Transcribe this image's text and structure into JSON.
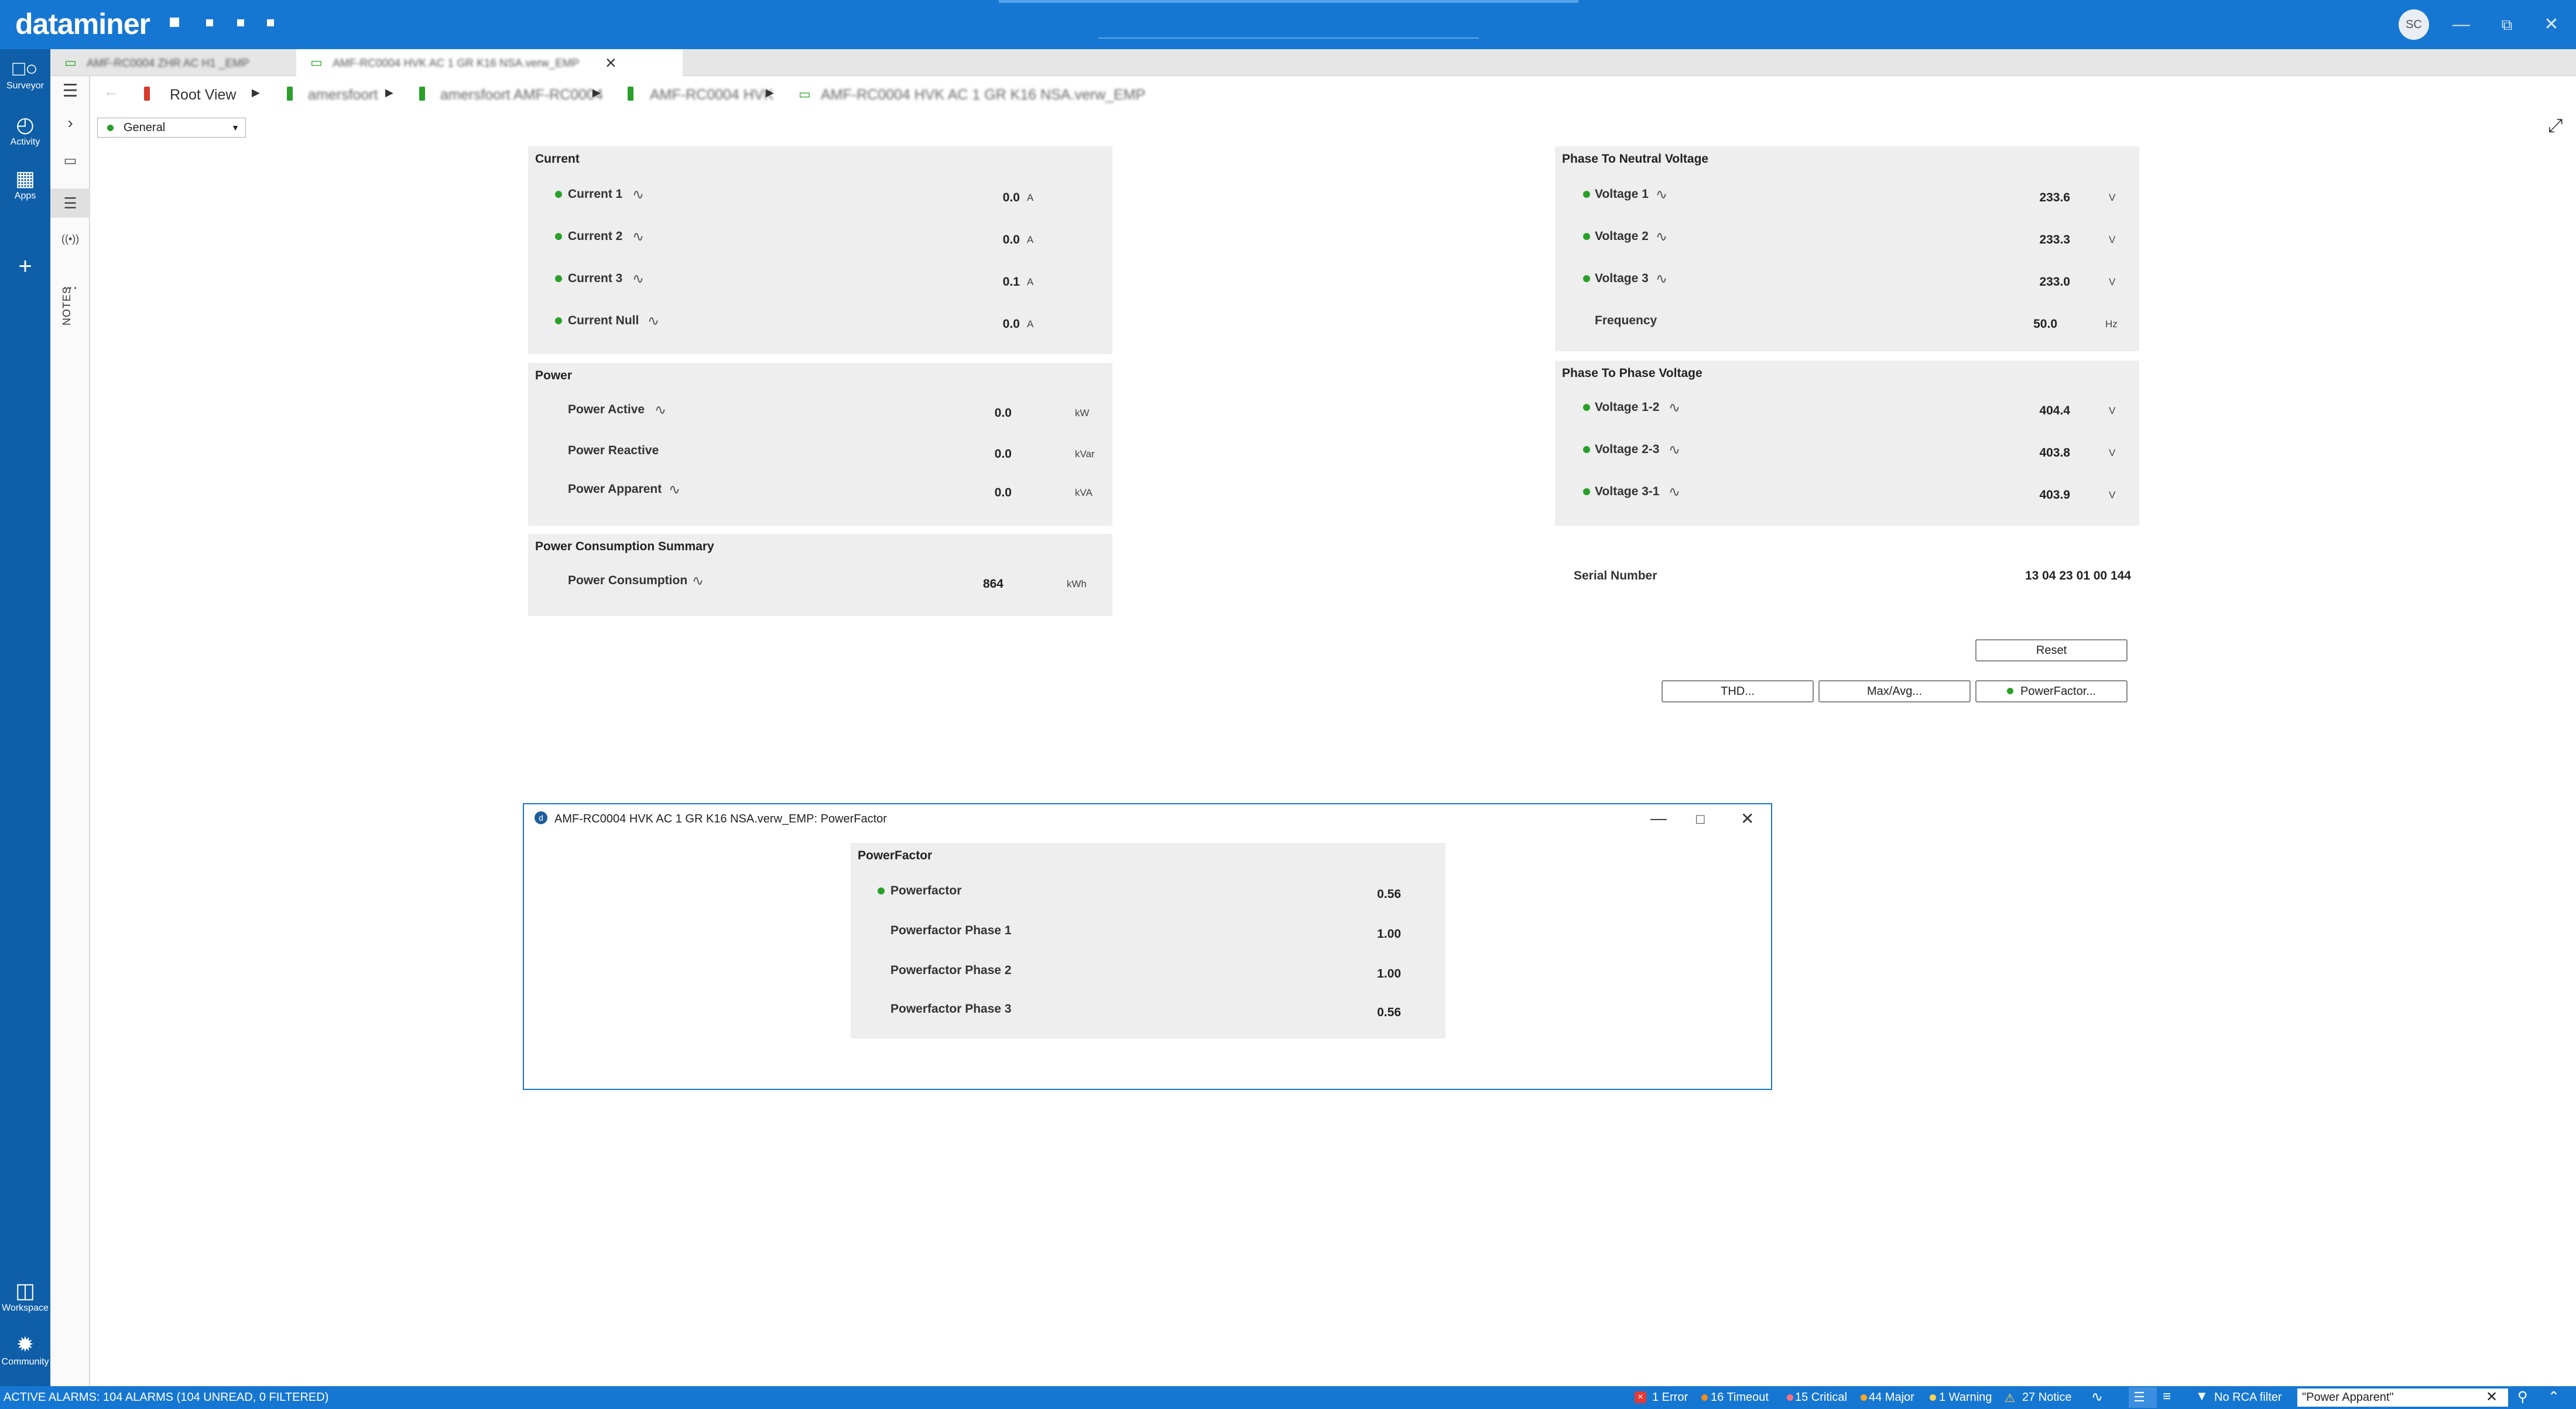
{
  "app": {
    "brand": "dataminer",
    "avatar_initials": "SC"
  },
  "leftrail": {
    "items": [
      {
        "label": "Surveyor",
        "icon": "surveyor-icon"
      },
      {
        "label": "Activity",
        "icon": "activity-icon"
      },
      {
        "label": "Apps",
        "icon": "apps-icon"
      },
      {
        "label": "Workspace",
        "icon": "workspace-icon"
      },
      {
        "label": "Community",
        "icon": "community-icon"
      }
    ]
  },
  "notes_label": "NOTES",
  "tabs": [
    {
      "label": "AMF-RC0004 ZHR AC H1 _EMP"
    },
    {
      "label": "AMF-RC0004 HVK AC 1 GR K16 NSA.verw_EMP"
    }
  ],
  "breadcrumb": {
    "root": "Root View",
    "items": [
      "amersfoort",
      "amersfoort AMF-RC0004",
      "AMF-RC0004 HVK",
      "AMF-RC0004 HVK AC 1 GR K16 NSA.verw_EMP"
    ]
  },
  "view_select": "General",
  "panels": {
    "current": {
      "title": "Current",
      "rows": [
        {
          "label": "Current 1",
          "value": "0.0",
          "unit": "A"
        },
        {
          "label": "Current 2",
          "value": "0.0",
          "unit": "A"
        },
        {
          "label": "Current 3",
          "value": "0.1",
          "unit": "A"
        },
        {
          "label": "Current Null",
          "value": "0.0",
          "unit": "A"
        }
      ]
    },
    "power": {
      "title": "Power",
      "rows": [
        {
          "label": "Power Active",
          "value": "0.0",
          "unit": "kW"
        },
        {
          "label": "Power Reactive",
          "value": "0.0",
          "unit": "kVar"
        },
        {
          "label": "Power Apparent",
          "value": "0.0",
          "unit": "kVA"
        }
      ]
    },
    "consumption": {
      "title": "Power Consumption Summary",
      "rows": [
        {
          "label": "Power Consumption",
          "value": "864",
          "unit": "kWh"
        }
      ]
    },
    "neutral": {
      "title": "Phase To Neutral Voltage",
      "rows": [
        {
          "label": "Voltage 1",
          "value": "233.6",
          "unit": "V"
        },
        {
          "label": "Voltage 2",
          "value": "233.3",
          "unit": "V"
        },
        {
          "label": "Voltage 3",
          "value": "233.0",
          "unit": "V"
        },
        {
          "label": "Frequency",
          "value": "50.0",
          "unit": "Hz"
        }
      ]
    },
    "phase": {
      "title": "Phase To Phase Voltage",
      "rows": [
        {
          "label": "Voltage 1-2",
          "value": "404.4",
          "unit": "V"
        },
        {
          "label": "Voltage 2-3",
          "value": "403.8",
          "unit": "V"
        },
        {
          "label": "Voltage 3-1",
          "value": "403.9",
          "unit": "V"
        }
      ]
    }
  },
  "serial": {
    "label": "Serial Number",
    "value": "13 04 23 01 00 144"
  },
  "buttons": {
    "reset": "Reset",
    "thd": "THD...",
    "maxavg": "Max/Avg...",
    "powerfactor": "PowerFactor..."
  },
  "popup": {
    "title": "AMF-RC0004 HVK AC 1 GR K16 NSA.verw_EMP: PowerFactor",
    "panel_title": "PowerFactor",
    "rows": [
      {
        "label": "Powerfactor",
        "value": "0.56"
      },
      {
        "label": "Powerfactor Phase 1",
        "value": "1.00"
      },
      {
        "label": "Powerfactor Phase 2",
        "value": "1.00"
      },
      {
        "label": "Powerfactor Phase 3",
        "value": "0.56"
      }
    ]
  },
  "statusbar": {
    "alarms": "ACTIVE ALARMS: 104 ALARMS (104 UNREAD, 0 FILTERED)",
    "error": "1 Error",
    "timeout": "16 Timeout",
    "critical": "15 Critical",
    "major": "44 Major",
    "warning": "1 Warning",
    "notice": "27 Notice",
    "rca": "No RCA filter",
    "search": "\"Power Apparent\""
  },
  "colors": {
    "brand_blue": "#1677d2",
    "rail_blue": "#0e5ea8",
    "led_green": "#2aa02a",
    "panel_bg": "#eeeeee",
    "error_red": "#e53935",
    "timeout_orange": "#f08c1c",
    "critical_pink": "#ff6f80",
    "major_orange": "#ffa726",
    "warning_yellow": "#ffd54f",
    "notice_blue": "#7fb8f0"
  }
}
